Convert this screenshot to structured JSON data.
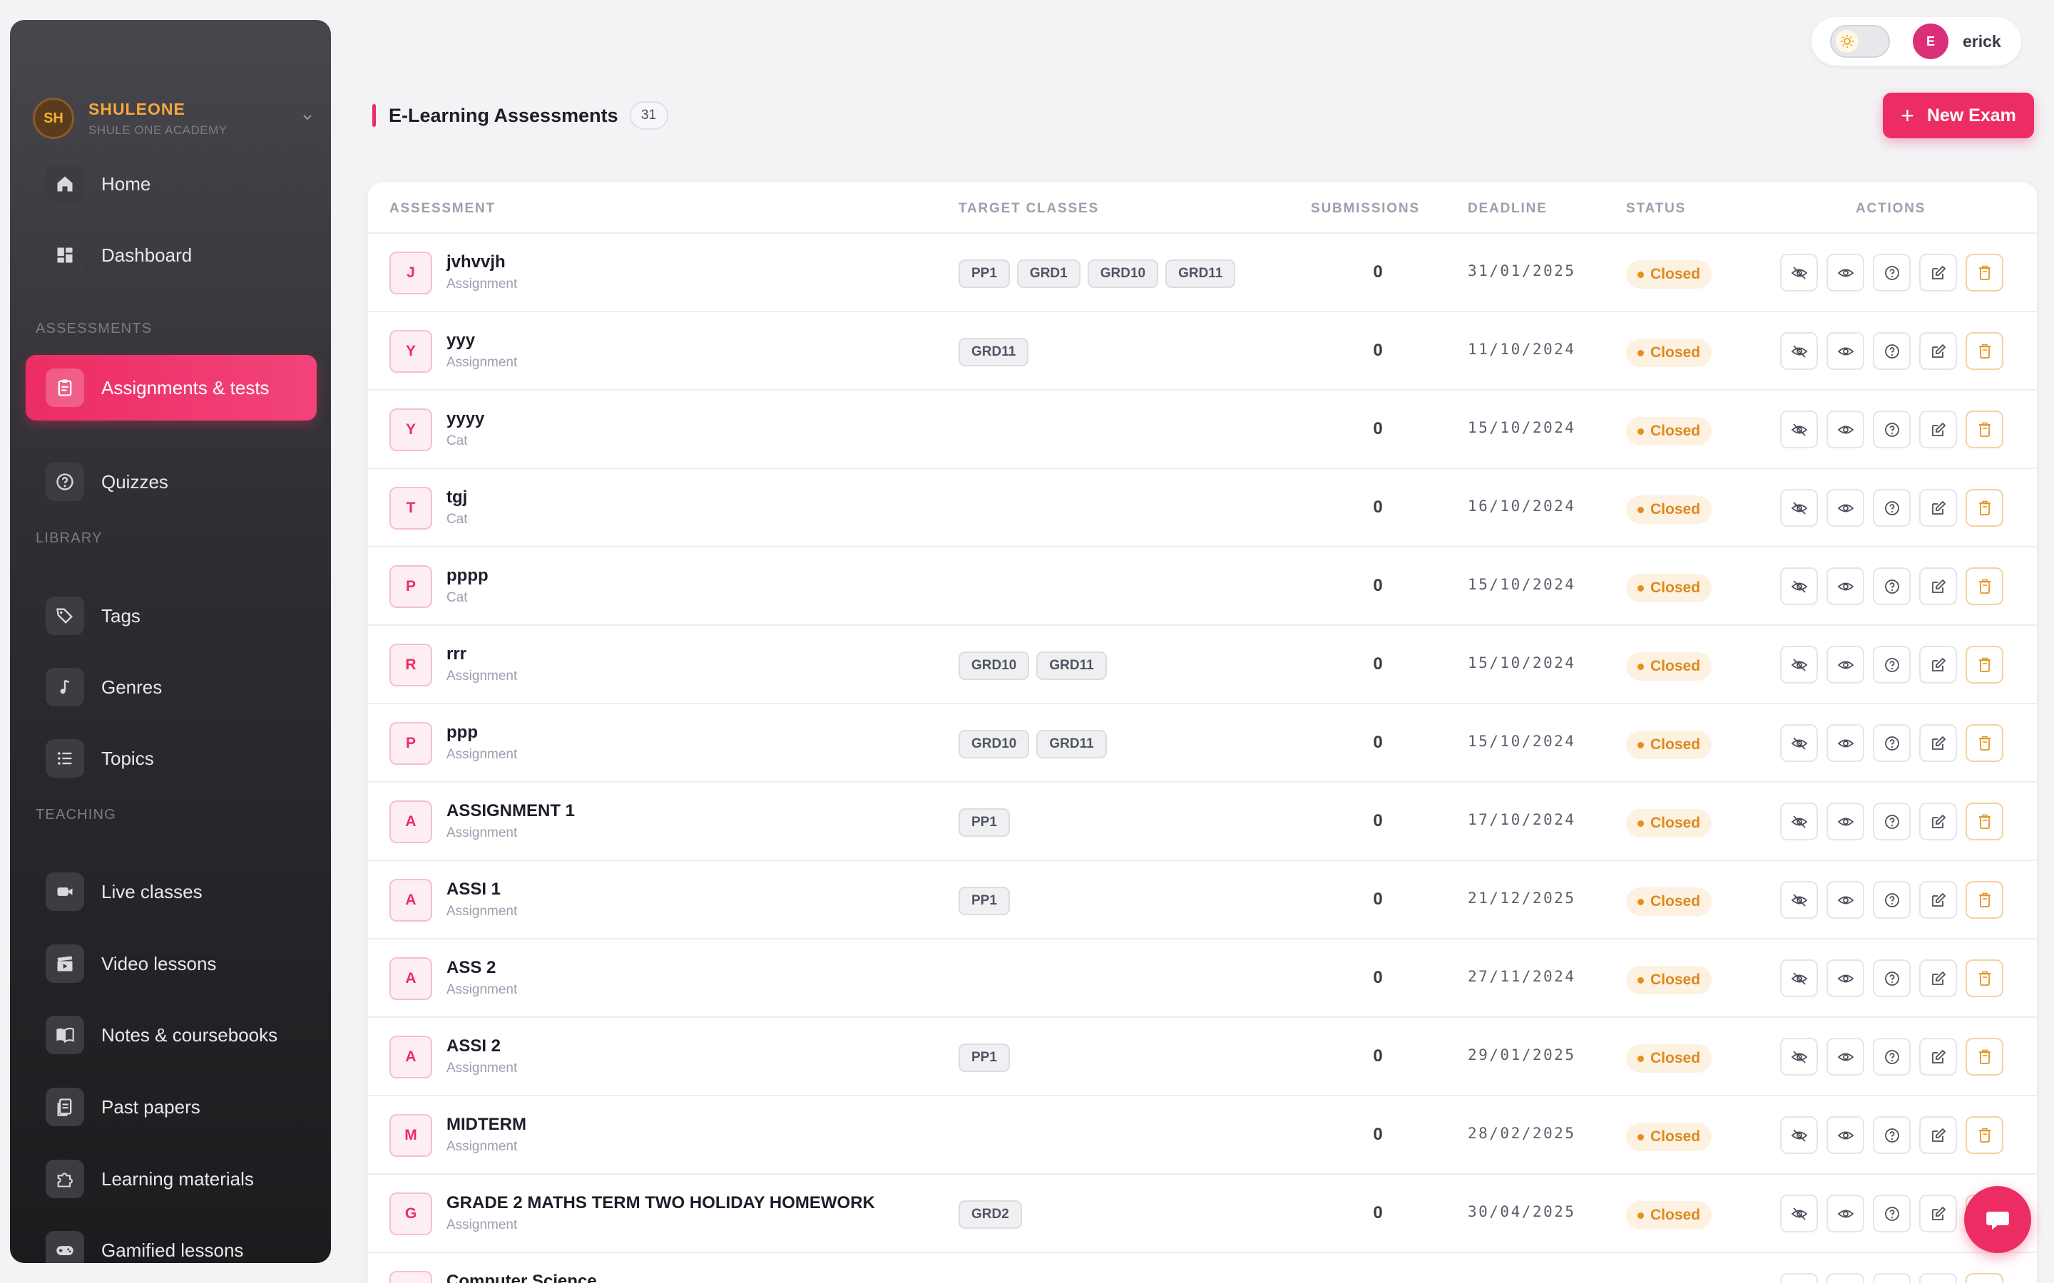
{
  "brand": {
    "initials": "SH",
    "name": "SHULEONE",
    "subtitle": "SHULE ONE ACADEMY"
  },
  "sidebar": {
    "items": [
      {
        "label": "Home",
        "icon": "home-icon"
      },
      {
        "label": "Dashboard",
        "icon": "dashboard-icon"
      },
      {
        "label": "Assignments & tests",
        "icon": "clipboard-icon",
        "active": true
      },
      {
        "label": "Quizzes",
        "icon": "question-circle-icon"
      },
      {
        "label": "Tags",
        "icon": "tags-icon"
      },
      {
        "label": "Genres",
        "icon": "music-note-icon"
      },
      {
        "label": "Topics",
        "icon": "list-icon"
      },
      {
        "label": "Live classes",
        "icon": "video-camera-icon"
      },
      {
        "label": "Video lessons",
        "icon": "clapperboard-icon"
      },
      {
        "label": "Notes & coursebooks",
        "icon": "book-open-icon"
      },
      {
        "label": "Past papers",
        "icon": "document-copy-icon"
      },
      {
        "label": "Learning materials",
        "icon": "puzzle-icon"
      },
      {
        "label": "Gamified lessons",
        "icon": "gamepad-icon"
      }
    ],
    "sections": {
      "assessments": "ASSESSMENTS",
      "library": "LIBRARY",
      "teaching": "TEACHING"
    }
  },
  "user": {
    "initial": "E",
    "name": "erick"
  },
  "header": {
    "title": "E-Learning Assessments",
    "count": "31",
    "new_button": "New Exam"
  },
  "table": {
    "columns": [
      "ASSESSMENT",
      "TARGET CLASSES",
      "SUBMISSIONS",
      "DEADLINE",
      "STATUS",
      "ACTIONS"
    ],
    "rows": [
      {
        "initial": "J",
        "name": "jvhvvjh",
        "type": "Assignment",
        "classes": [
          "PP1",
          "GRD1",
          "GRD10",
          "GRD11"
        ],
        "submissions": "0",
        "deadline": "31/01/2025",
        "status": "Closed"
      },
      {
        "initial": "Y",
        "name": "yyy",
        "type": "Assignment",
        "classes": [
          "GRD11"
        ],
        "submissions": "0",
        "deadline": "11/10/2024",
        "status": "Closed"
      },
      {
        "initial": "Y",
        "name": "yyyy",
        "type": "Cat",
        "classes": [],
        "submissions": "0",
        "deadline": "15/10/2024",
        "status": "Closed"
      },
      {
        "initial": "T",
        "name": "tgj",
        "type": "Cat",
        "classes": [],
        "submissions": "0",
        "deadline": "16/10/2024",
        "status": "Closed"
      },
      {
        "initial": "P",
        "name": "pppp",
        "type": "Cat",
        "classes": [],
        "submissions": "0",
        "deadline": "15/10/2024",
        "status": "Closed"
      },
      {
        "initial": "R",
        "name": "rrr",
        "type": "Assignment",
        "classes": [
          "GRD10",
          "GRD11"
        ],
        "submissions": "0",
        "deadline": "15/10/2024",
        "status": "Closed"
      },
      {
        "initial": "P",
        "name": "ppp",
        "type": "Assignment",
        "classes": [
          "GRD10",
          "GRD11"
        ],
        "submissions": "0",
        "deadline": "15/10/2024",
        "status": "Closed"
      },
      {
        "initial": "A",
        "name": "ASSIGNMENT 1",
        "type": "Assignment",
        "classes": [
          "PP1"
        ],
        "submissions": "0",
        "deadline": "17/10/2024",
        "status": "Closed"
      },
      {
        "initial": "A",
        "name": "ASSI 1",
        "type": "Assignment",
        "classes": [
          "PP1"
        ],
        "submissions": "0",
        "deadline": "21/12/2025",
        "status": "Closed"
      },
      {
        "initial": "A",
        "name": "ASS 2",
        "type": "Assignment",
        "classes": [],
        "submissions": "0",
        "deadline": "27/11/2024",
        "status": "Closed"
      },
      {
        "initial": "A",
        "name": "ASSI 2",
        "type": "Assignment",
        "classes": [
          "PP1"
        ],
        "submissions": "0",
        "deadline": "29/01/2025",
        "status": "Closed"
      },
      {
        "initial": "M",
        "name": "MIDTERM",
        "type": "Assignment",
        "classes": [],
        "submissions": "0",
        "deadline": "28/02/2025",
        "status": "Closed"
      },
      {
        "initial": "G",
        "name": "GRADE 2 MATHS TERM TWO HOLIDAY HOMEWORK",
        "type": "Assignment",
        "classes": [
          "GRD2"
        ],
        "submissions": "0",
        "deadline": "30/04/2025",
        "status": "Closed"
      },
      {
        "initial": "C",
        "name": "Computer Science",
        "type": "",
        "classes": [],
        "submissions": "",
        "deadline": "",
        "status": ""
      }
    ],
    "actions": [
      "hide-icon",
      "view-icon",
      "help-icon",
      "edit-icon",
      "delete-icon"
    ]
  },
  "colors": {
    "accent": "#ec2d63",
    "status_closed": "#dc8a1e",
    "brand_name": "#f6a63b"
  }
}
